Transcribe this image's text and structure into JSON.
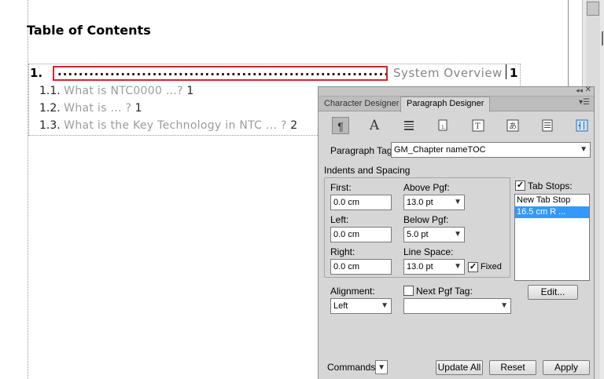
{
  "document": {
    "title": "Table of Contents",
    "entries": [
      {
        "number": "1.",
        "leader": "..........................................................................",
        "text": "System Overview",
        "page": "1"
      },
      {
        "number": "1.1.",
        "text": "What is NTC0000 ...?",
        "page": "1"
      },
      {
        "number": "1.2.",
        "text": "What is ... ?",
        "page": "1"
      },
      {
        "number": "1.3.",
        "text": "What is the Key Technology in NTC ... ?",
        "page": "2"
      }
    ]
  },
  "panel": {
    "tabs": [
      {
        "label": "Character Designer",
        "active": false
      },
      {
        "label": "Paragraph Designer",
        "active": true
      }
    ],
    "icon_buttons": [
      "paragraph-icon",
      "font-icon",
      "pagination-icon",
      "numbering-icon",
      "advanced-icon",
      "asian-icon",
      "table-cell-icon",
      "direction-icon"
    ],
    "paragraph_tag": {
      "label": "Paragraph Tag:",
      "value": "GM_Chapter nameTOC"
    },
    "section_title": "Indents and Spacing",
    "first": {
      "label": "First:",
      "value": "0.0 cm"
    },
    "left": {
      "label": "Left:",
      "value": "0.0 cm"
    },
    "right": {
      "label": "Right:",
      "value": "0.0 cm"
    },
    "above_pgf": {
      "label": "Above Pgf:",
      "value": "13.0 pt"
    },
    "below_pgf": {
      "label": "Below Pgf:",
      "value": "5.0 pt"
    },
    "line_space": {
      "label": "Line Space:",
      "value": "13.0 pt",
      "fixed_label": "Fixed",
      "fixed_checked": true
    },
    "tab_stops": {
      "label": "Tab Stops:",
      "checked": true,
      "items": [
        "New Tab Stop",
        "16.5 cm  R  ..."
      ],
      "selected_index": 1
    },
    "edit_button": "Edit...",
    "alignment": {
      "label": "Alignment:",
      "value": "Left"
    },
    "next_pgf_tag": {
      "label": "Next Pgf Tag:",
      "checked": false,
      "value": ""
    },
    "commands_label": "Commands:",
    "update_all_button": "Update All",
    "reset_button": "Reset",
    "apply_button": "Apply"
  },
  "colors": {
    "selection_border": "#d3242d",
    "list_selection": "#3399ff",
    "panel_bg": "#d6d6d6"
  }
}
